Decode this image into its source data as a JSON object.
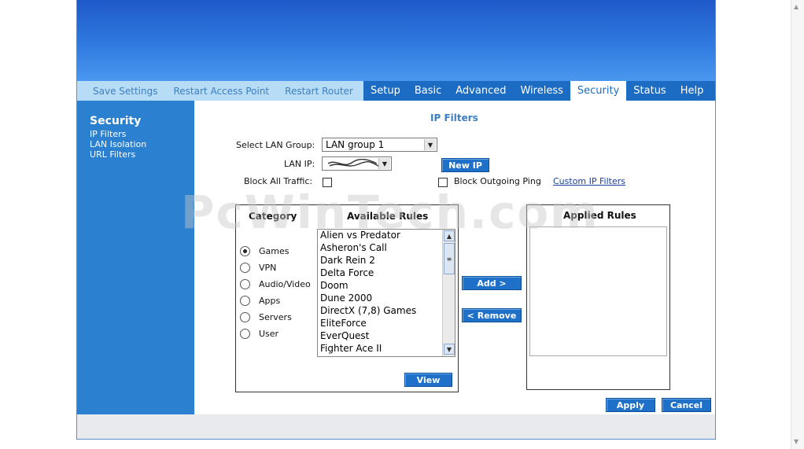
{
  "utility_links": [
    "Save Settings",
    "Restart Access Point",
    "Restart Router"
  ],
  "tabs": [
    {
      "label": "Setup",
      "active": false
    },
    {
      "label": "Basic",
      "active": false
    },
    {
      "label": "Advanced",
      "active": false
    },
    {
      "label": "Wireless",
      "active": false
    },
    {
      "label": "Security",
      "active": true
    },
    {
      "label": "Status",
      "active": false
    },
    {
      "label": "Help",
      "active": false
    }
  ],
  "sidebar": {
    "title": "Security",
    "items": [
      "IP Filters",
      "LAN Isolation",
      "URL Filters"
    ]
  },
  "page": {
    "title": "IP Filters",
    "lan_group_label": "Select LAN Group:",
    "lan_group_value": "LAN group 1",
    "lan_ip_label": "LAN IP:",
    "new_ip_button": "New IP",
    "block_all_label": "Block All Traffic:",
    "block_ping_label": "Block Outgoing Ping",
    "custom_filters_link": "Custom IP Filters",
    "category_header": "Category",
    "available_header": "Available Rules",
    "applied_header": "Applied Rules",
    "categories": [
      "Games",
      "VPN",
      "Audio/Video",
      "Apps",
      "Servers",
      "User"
    ],
    "selected_category": "Games",
    "available_rules": [
      "Alien vs Predator",
      "Asheron's Call",
      "Dark Rein 2",
      "Delta Force",
      "Doom",
      "Dune 2000",
      "DirectX (7,8) Games",
      "EliteForce",
      "EverQuest",
      "Fighter Ace II"
    ],
    "add_button": "Add >",
    "remove_button": "< Remove",
    "view_button": "View",
    "apply_button": "Apply",
    "cancel_button": "Cancel"
  },
  "watermark": "PcWinTech.com",
  "colors": {
    "tab_bar": "#1c6cc4",
    "util_bar": "#b6dcf6",
    "sidebar": "#2c80d0",
    "button": "#1e70c8",
    "title_text": "#3d7fc1"
  }
}
